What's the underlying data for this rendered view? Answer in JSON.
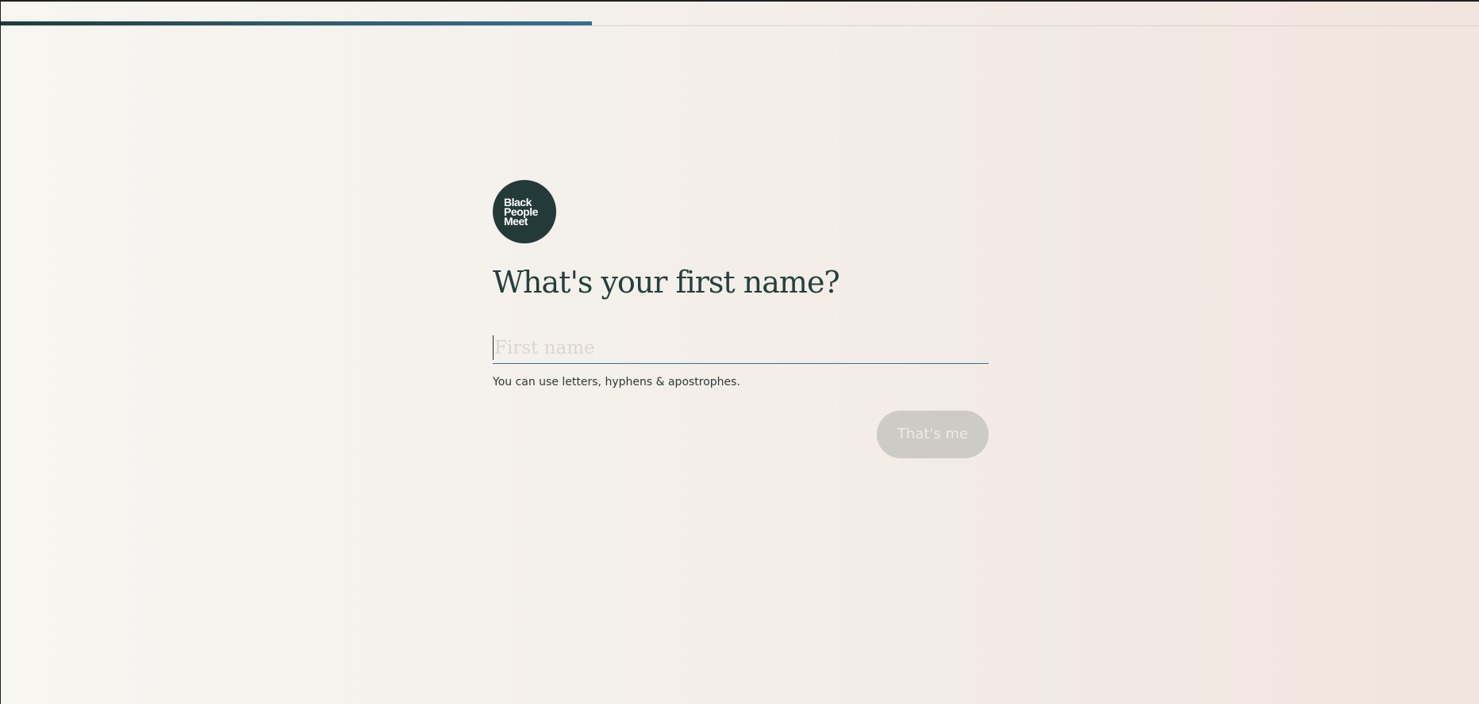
{
  "progress": {
    "fraction": 0.4
  },
  "logo": {
    "lines": [
      "Black",
      "People",
      "Meet"
    ]
  },
  "form": {
    "title": "What's your first name?",
    "input": {
      "value": "",
      "placeholder": "First name"
    },
    "hint": "You can use letters, hyphens & apostrophes.",
    "submit_label": "That's me",
    "submit_disabled": true
  },
  "colors": {
    "brand": "#233a38",
    "accent": "#346f97",
    "button_disabled": "#cccbc6"
  }
}
